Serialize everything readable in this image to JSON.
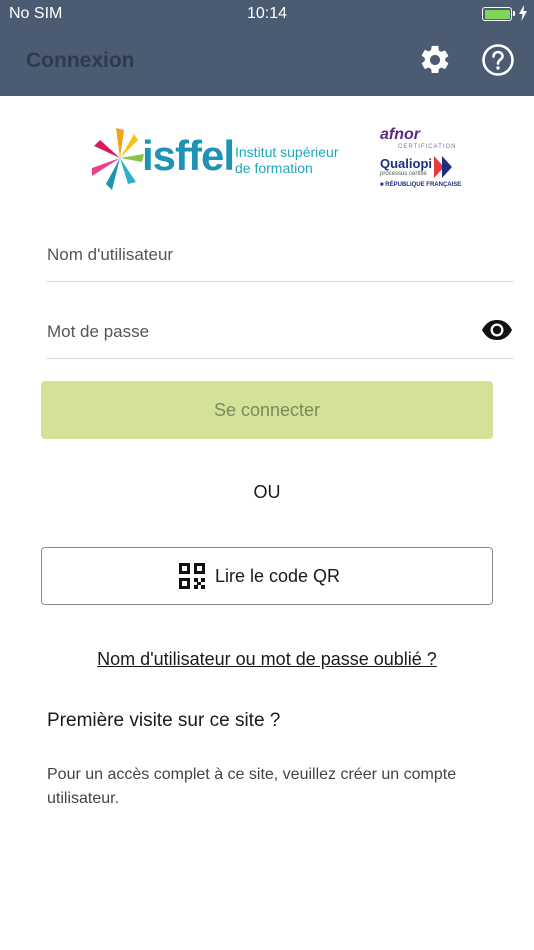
{
  "status_bar": {
    "carrier": "No SIM",
    "time": "10:14",
    "battery_level": 1.0,
    "icons": [
      "battery-icon",
      "charging-icon"
    ]
  },
  "nav": {
    "title": "Connexion",
    "icons": [
      "gear-icon",
      "help-icon"
    ]
  },
  "logos": {
    "isffel_word": "isffel",
    "isffel_tagline_1": "Institut supérieur",
    "isffel_tagline_2": "de formation",
    "afnor": "afnor",
    "afnor_sub": "CERTIFICATION",
    "qualiopi": "Qualiopi",
    "qualiopi_sub": "processus certifié",
    "republique": "■ RÉPUBLIQUE FRANÇAISE"
  },
  "form": {
    "username_placeholder": "Nom d'utilisateur",
    "password_placeholder": "Mot de passe",
    "password_icon": "eye-icon",
    "login_button": "Se connecter"
  },
  "separator": "OU",
  "qr_button": {
    "label": "Lire le code QR",
    "icon": "qr-code-icon"
  },
  "forgot_link": "Nom d'utilisateur ou mot de passe oublié ?",
  "first_visit": {
    "heading": "Première visite sur ce site ?",
    "text": "Pour un accès complet à ce site, veuillez créer un compte utilisateur."
  },
  "colors": {
    "nav_bg": "#4a5b72",
    "login_button_bg": "#d3e296",
    "brand_blue": "#1f93b5",
    "afnor_purple": "#5c2a82"
  }
}
